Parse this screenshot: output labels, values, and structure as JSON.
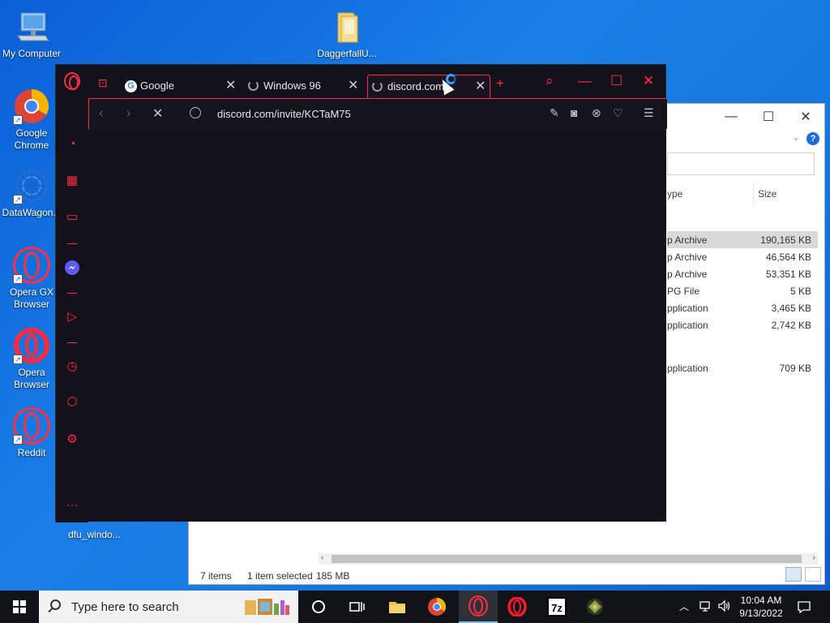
{
  "desktop": {
    "icons": [
      {
        "label": "My Computer"
      },
      {
        "label": "DaggerfallU..."
      },
      {
        "label": "Google Chrome"
      },
      {
        "label": "DataWagon..."
      },
      {
        "label": "Opera GX Browser"
      },
      {
        "label": "Opera Browser"
      },
      {
        "label": "Reddit"
      }
    ],
    "dfu_label": "dfu_windo..."
  },
  "explorer": {
    "columns": {
      "type": "ype",
      "size": "Size"
    },
    "rows": [
      {
        "type": "p Archive",
        "size": "190,165 KB",
        "selected": true
      },
      {
        "type": "p Archive",
        "size": "46,564 KB",
        "selected": false
      },
      {
        "type": "p Archive",
        "size": "53,351 KB",
        "selected": false
      },
      {
        "type": "PG File",
        "size": "5 KB",
        "selected": false
      },
      {
        "type": "pplication",
        "size": "3,465 KB",
        "selected": false
      },
      {
        "type": "pplication",
        "size": "2,742 KB",
        "selected": false
      },
      {
        "type": "pplication",
        "size": "709 KB",
        "selected": false
      }
    ],
    "status": {
      "items": "7 items",
      "selected": "1 item selected",
      "size": "185 MB"
    },
    "help": "?"
  },
  "browser": {
    "tabs": [
      {
        "title": "Google"
      },
      {
        "title": "Windows 96"
      },
      {
        "title": "discord.com"
      }
    ],
    "url": "discord.com/invite/KCTaM75",
    "accent": "#ff2d48"
  },
  "taskbar": {
    "search_placeholder": "Type here to search",
    "time": "10:04 AM",
    "date": "9/13/2022",
    "seven_zip": "7z"
  }
}
